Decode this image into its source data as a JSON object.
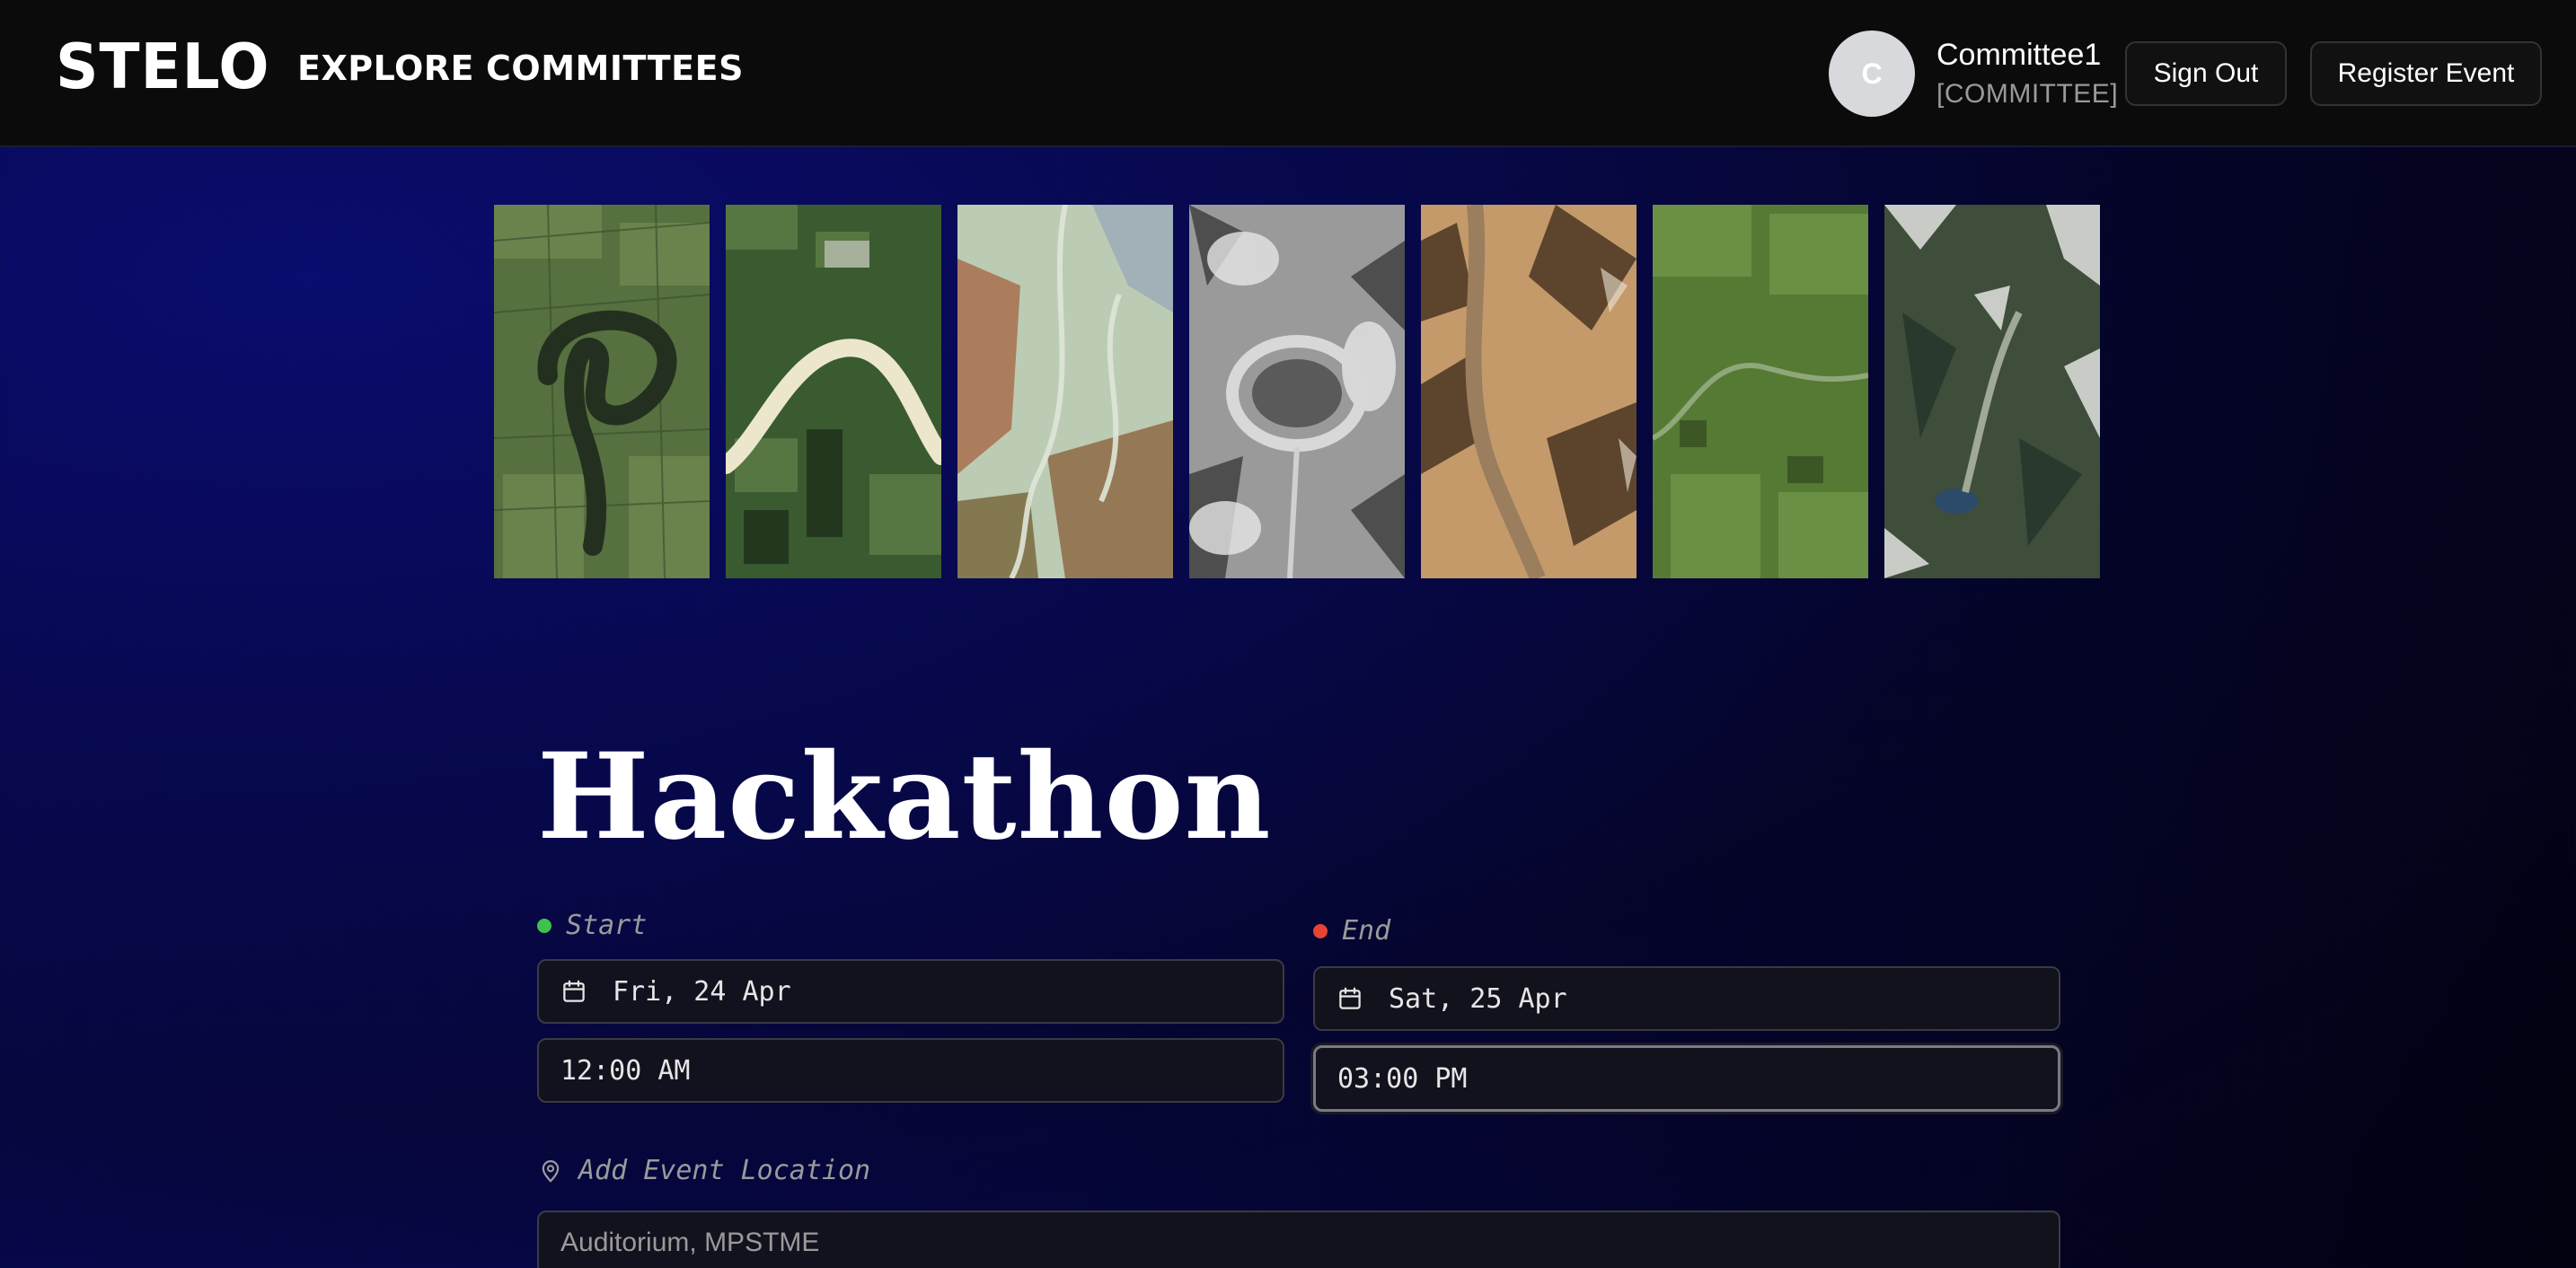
{
  "header": {
    "logo": "STELO",
    "nav": {
      "explore": "EXPLORE",
      "committees": "COMMITTEES"
    },
    "user": {
      "initial": "C",
      "name": "Committee1",
      "role": "[COMMITTEE]"
    },
    "buttons": {
      "sign_out": "Sign Out",
      "register_event": "Register Event"
    }
  },
  "gallery": {
    "tiles": [
      {
        "name": "oxbow-lake-farmland",
        "colors": [
          "#4a6a3a",
          "#2a3a28",
          "#6a7a4a"
        ]
      },
      {
        "name": "meandering-river-fields",
        "colors": [
          "#2e4a2a",
          "#e8e2c8",
          "#4a6a3a"
        ]
      },
      {
        "name": "braided-river-delta",
        "colors": [
          "#b8c8b0",
          "#a86a4a",
          "#8a9a7a"
        ]
      },
      {
        "name": "impact-crater-snow",
        "colors": [
          "#e0e0e0",
          "#3a3a3a",
          "#a0a0a0"
        ]
      },
      {
        "name": "desert-mountain-valley",
        "colors": [
          "#c8a070",
          "#3a2a1a",
          "#8a6a4a"
        ]
      },
      {
        "name": "green-river-plain",
        "colors": [
          "#4a6a2a",
          "#6a8a4a",
          "#2a3a1a"
        ]
      },
      {
        "name": "alpine-valley-lake",
        "colors": [
          "#3a4a3a",
          "#d8d8d8",
          "#2a3a4a"
        ]
      }
    ]
  },
  "event": {
    "title": "Hackathon",
    "start": {
      "label": "Start",
      "date": "Fri, 24 Apr",
      "time": "12:00 AM"
    },
    "end": {
      "label": "End",
      "date": "Sat, 25 Apr",
      "time": "03:00 PM"
    },
    "location": {
      "label": "Add Event Location",
      "value": "Auditorium, MPSTME"
    }
  },
  "colors": {
    "start_dot": "#3ec24a",
    "end_dot": "#e84434"
  }
}
